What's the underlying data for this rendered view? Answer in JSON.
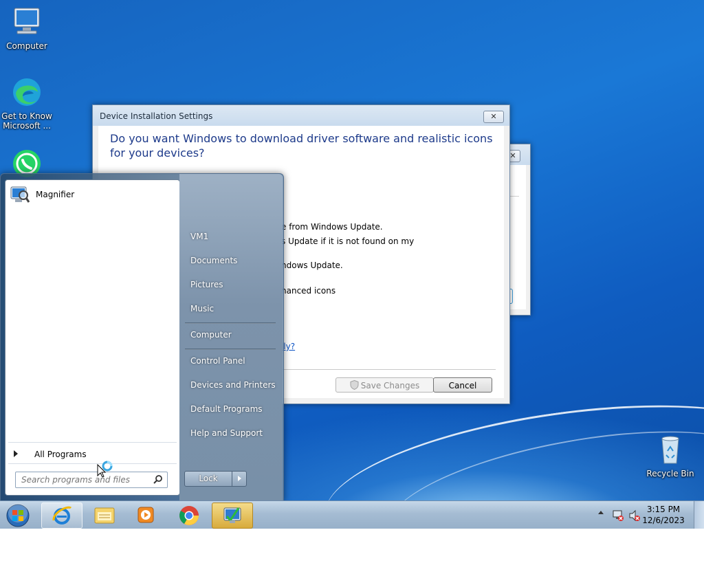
{
  "desktop": {
    "icons": [
      {
        "label": "Computer",
        "icon": "computer-icon"
      },
      {
        "label_line1": "Get to Know",
        "label_line2": "Microsoft ...",
        "icon": "edge-icon"
      },
      {
        "icon": "whatsapp-icon"
      },
      {
        "label": "Recycle Bin",
        "icon": "recycle-bin-icon"
      }
    ]
  },
  "back_dialog": {
    "close": "✕"
  },
  "dialog": {
    "title": "Device Installation Settings",
    "close": "✕",
    "question": "Do you want Windows to download driver software and realistic icons for your devices?",
    "line1": "e from Windows Update.",
    "line2": "s Update if it is not found on my",
    "line3": "ndows Update.",
    "line4": "hanced icons",
    "link": "lly?",
    "save_label": "Save Changes",
    "cancel_label": "Cancel"
  },
  "start_menu": {
    "pinned": [
      {
        "label": "Magnifier",
        "icon": "magnifier-icon"
      }
    ],
    "all_programs": "All Programs",
    "search_placeholder": "Search programs and files",
    "right_items": [
      "VM1",
      "Documents",
      "Pictures",
      "Music",
      "Computer",
      "Control Panel",
      "Devices and Printers",
      "Default Programs",
      "Help and Support"
    ],
    "lock_label": "Lock"
  },
  "taskbar": {
    "apps": [
      "start-orb-icon",
      "internet-explorer-icon",
      "file-explorer-icon",
      "media-player-icon",
      "chrome-icon",
      "device-settings-icon"
    ],
    "time": "3:15 PM",
    "date": "12/6/2023"
  },
  "colors": {
    "accent": "#1d3a8a",
    "desktop": "#1a78d6"
  }
}
